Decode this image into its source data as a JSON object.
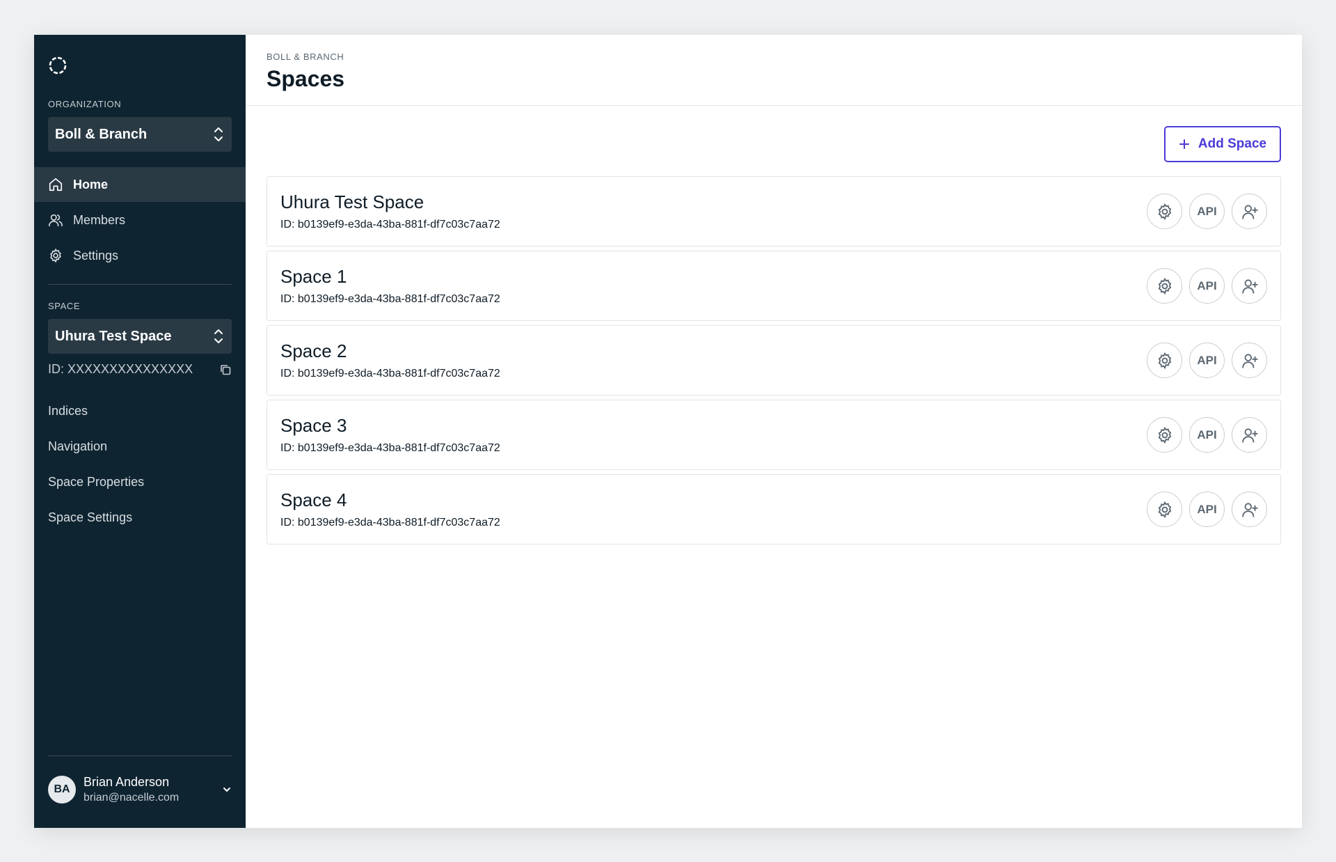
{
  "sidebar": {
    "organization_label": "ORGANIZATION",
    "organization_value": "Boll & Branch",
    "nav": [
      {
        "label": "Home"
      },
      {
        "label": "Members"
      },
      {
        "label": "Settings"
      }
    ],
    "space_label": "SPACE",
    "space_value": "Uhura Test Space",
    "space_id": "ID: XXXXXXXXXXXXXXX",
    "space_nav": [
      {
        "label": "Indices"
      },
      {
        "label": "Navigation"
      },
      {
        "label": "Space Properties"
      },
      {
        "label": "Space Settings"
      }
    ],
    "user": {
      "initials": "BA",
      "name": "Brian Anderson",
      "email": "brian@nacelle.com"
    }
  },
  "header": {
    "breadcrumb": "BOLL & BRANCH",
    "title": "Spaces"
  },
  "main": {
    "add_button_label": "Add Space",
    "api_label": "API",
    "spaces": [
      {
        "name": "Uhura Test Space",
        "id": "ID: b0139ef9-e3da-43ba-881f-df7c03c7aa72"
      },
      {
        "name": "Space 1",
        "id": "ID: b0139ef9-e3da-43ba-881f-df7c03c7aa72"
      },
      {
        "name": "Space 2",
        "id": "ID: b0139ef9-e3da-43ba-881f-df7c03c7aa72"
      },
      {
        "name": "Space 3",
        "id": "ID: b0139ef9-e3da-43ba-881f-df7c03c7aa72"
      },
      {
        "name": "Space 4",
        "id": "ID: b0139ef9-e3da-43ba-881f-df7c03c7aa72"
      }
    ]
  },
  "colors": {
    "sidebar_bg": "#0f2431",
    "sidebar_active": "#2a3a45",
    "accent": "#4b3ad8"
  }
}
